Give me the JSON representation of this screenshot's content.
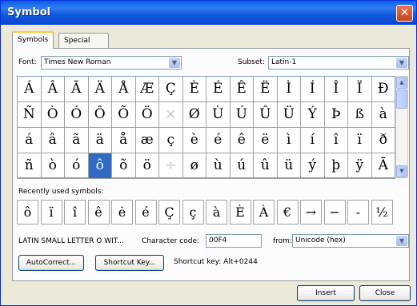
{
  "window": {
    "title": "Symbol",
    "close_glyph": "✕"
  },
  "tabs": [
    {
      "label": "Symbols",
      "active": true
    },
    {
      "label": "Special Characters",
      "active": false
    }
  ],
  "font": {
    "label": "Font:",
    "value": "Times New Roman"
  },
  "subset": {
    "label": "Subset:",
    "value": "Latin-1"
  },
  "symbols": [
    [
      "Á",
      "Â",
      "Ã",
      "Ä",
      "Å",
      "Æ",
      "Ç",
      "È",
      "É",
      "Ê",
      "Ë",
      "Ì",
      "Í",
      "Î",
      "Ï",
      "Ð"
    ],
    [
      "Ñ",
      "Ò",
      "Ó",
      "Ô",
      "Õ",
      "Ö",
      "×",
      "Ø",
      "Ù",
      "Ú",
      "Û",
      "Ü",
      "Ý",
      "Þ",
      "ß",
      "à"
    ],
    [
      "á",
      "â",
      "ã",
      "ä",
      "å",
      "æ",
      "ç",
      "è",
      "é",
      "ê",
      "ë",
      "ì",
      "í",
      "î",
      "ï",
      "ð"
    ],
    [
      "ñ",
      "ò",
      "ó",
      "ô",
      "õ",
      "ö",
      "÷",
      "ø",
      "ù",
      "ú",
      "û",
      "ü",
      "ý",
      "þ",
      "ÿ",
      "Ā"
    ]
  ],
  "selected_symbol": "ô",
  "recent": {
    "label": "Recently used symbols:",
    "items": [
      "ô",
      "ï",
      "î",
      "ê",
      "ė",
      "é",
      "Ç",
      "ç",
      "à",
      "È",
      "À",
      "€",
      "→",
      "−",
      "-",
      "½"
    ]
  },
  "char_name": "LATIN SMALL LETTER O WIT...",
  "char_code": {
    "label": "Character code:",
    "value": "00F4"
  },
  "from": {
    "label": "from:",
    "value": "Unicode (hex)"
  },
  "buttons": {
    "autocorrect": "AutoCorrect...",
    "shortcut_key": "Shortcut Key...",
    "insert": "Insert",
    "close": "Close"
  },
  "shortcut_text": "Shortcut key: Alt+0244",
  "colors": {
    "titlebar": "#0a5fe8",
    "selection": "#316ac5",
    "face": "#ece9d8"
  }
}
